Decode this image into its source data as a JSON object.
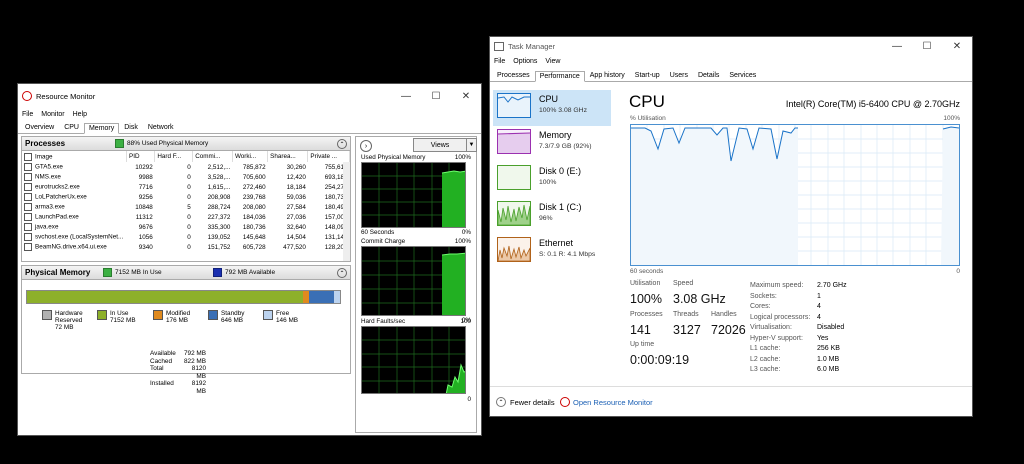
{
  "resource_monitor": {
    "title": "Resource Monitor",
    "menu": [
      "File",
      "Monitor",
      "Help"
    ],
    "tabs": [
      "Overview",
      "CPU",
      "Memory",
      "Disk",
      "Network"
    ],
    "active_tab": "Memory",
    "processes": {
      "title": "Processes",
      "status": "88% Used Physical Memory",
      "columns": [
        "Image",
        "PID",
        "Hard F...",
        "Commi...",
        "Worki...",
        "Sharea...",
        "Private ..."
      ],
      "rows": [
        [
          "GTA5.exe",
          "10292",
          "0",
          "2,512,...",
          "785,872",
          "30,260",
          "755,612"
        ],
        [
          "NMS.exe",
          "9988",
          "0",
          "3,528,...",
          "705,600",
          "12,420",
          "693,180"
        ],
        [
          "eurotrucks2.exe",
          "7716",
          "0",
          "1,615,...",
          "272,460",
          "18,184",
          "254,276"
        ],
        [
          "LoLPatcherUx.exe",
          "9256",
          "0",
          "208,908",
          "239,768",
          "59,036",
          "180,732"
        ],
        [
          "arma3.exe",
          "10848",
          "5",
          "288,724",
          "208,080",
          "27,584",
          "180,496"
        ],
        [
          "LaunchPad.exe",
          "11312",
          "0",
          "227,372",
          "184,036",
          "27,036",
          "157,000"
        ],
        [
          "java.exe",
          "9676",
          "0",
          "335,300",
          "180,736",
          "32,640",
          "148,096"
        ],
        [
          "svchost.exe (LocalSystemNet...",
          "1056",
          "0",
          "139,052",
          "145,648",
          "14,504",
          "131,144"
        ],
        [
          "BeamNG.drive.x64.ui.exe",
          "9340",
          "0",
          "151,752",
          "605,728",
          "477,520",
          "128,208"
        ]
      ]
    },
    "physical_memory": {
      "title": "Physical Memory",
      "in_use": "7152 MB In Use",
      "available": "792 MB Available",
      "legend": [
        {
          "label": "Hardware Reserved",
          "value": "72 MB",
          "color": "#b0b0b0"
        },
        {
          "label": "In Use",
          "value": "7152 MB",
          "color": "#8db02a"
        },
        {
          "label": "Modified",
          "value": "176 MB",
          "color": "#e08a1e"
        },
        {
          "label": "Standby",
          "value": "646 MB",
          "color": "#3a6fb5"
        },
        {
          "label": "Free",
          "value": "146 MB",
          "color": "#bcd3ef"
        }
      ],
      "summary": [
        {
          "label": "Available",
          "value": "792 MB"
        },
        {
          "label": "Cached",
          "value": "822 MB"
        },
        {
          "label": "Total",
          "value": "8120 MB"
        },
        {
          "label": "Installed",
          "value": "8192 MB"
        }
      ]
    },
    "views_label": "Views",
    "graphs": [
      {
        "label": "Used Physical Memory",
        "max": "100%",
        "min": "0%",
        "footer": "60 Seconds"
      },
      {
        "label": "Commit Charge",
        "max": "100%",
        "min": "0%",
        "footer": ""
      },
      {
        "label": "Hard Faults/sec",
        "max": "100",
        "min": "0",
        "footer": ""
      }
    ]
  },
  "task_manager": {
    "title": "Task Manager",
    "menu": [
      "File",
      "Options",
      "View"
    ],
    "tabs": [
      "Processes",
      "Performance",
      "App history",
      "Start-up",
      "Users",
      "Details",
      "Services"
    ],
    "active_tab": "Performance",
    "sidebar": [
      {
        "name": "CPU",
        "sub": "100%  3.08 GHz",
        "color": "#1a73c8"
      },
      {
        "name": "Memory",
        "sub": "7.3/7.9 GB (92%)",
        "color": "#9b30b0"
      },
      {
        "name": "Disk 0 (E:)",
        "sub": "100%",
        "color": "#4aa02c"
      },
      {
        "name": "Disk 1 (C:)",
        "sub": "96%",
        "color": "#4aa02c"
      },
      {
        "name": "Ethernet",
        "sub": "S: 0.1  R: 4.1 Mbps",
        "color": "#b0621a"
      }
    ],
    "cpu": {
      "heading": "CPU",
      "model": "Intel(R) Core(TM) i5-6400 CPU @ 2.70GHz",
      "utilisation_label": "% Utilisation",
      "max": "100%",
      "time_label": "60 seconds",
      "min": "0",
      "stats": [
        {
          "label": "Utilisation",
          "value": "100%"
        },
        {
          "label": "Speed",
          "value": "3.08 GHz"
        },
        {
          "label": "Processes",
          "value": "141"
        },
        {
          "label": "Threads",
          "value": "3127"
        },
        {
          "label": "Handles",
          "value": "72026"
        },
        {
          "label": "Up time",
          "value": "0:00:09:19"
        }
      ],
      "specs": [
        {
          "label": "Maximum speed:",
          "value": "2.70 GHz"
        },
        {
          "label": "Sockets:",
          "value": "1"
        },
        {
          "label": "Cores:",
          "value": "4"
        },
        {
          "label": "Logical processors:",
          "value": "4"
        },
        {
          "label": "Virtualisation:",
          "value": "Disabled"
        },
        {
          "label": "Hyper-V support:",
          "value": "Yes"
        },
        {
          "label": "L1 cache:",
          "value": "256 KB"
        },
        {
          "label": "L2 cache:",
          "value": "1.0 MB"
        },
        {
          "label": "L3 cache:",
          "value": "6.0 MB"
        }
      ]
    },
    "footer": {
      "fewer": "Fewer details",
      "open_rm": "Open Resource Monitor"
    }
  }
}
